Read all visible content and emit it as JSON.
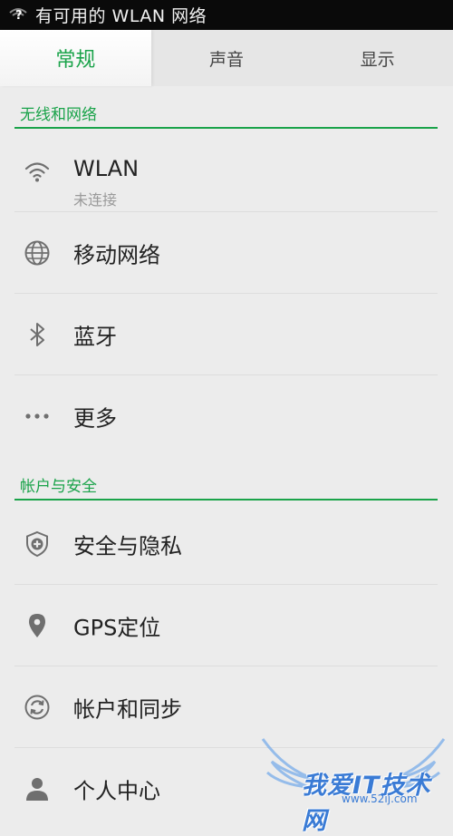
{
  "status_bar": {
    "wifi_symbol": "?",
    "text": "有可用的 WLAN 网络"
  },
  "tabs": [
    {
      "label": "常规",
      "active": true
    },
    {
      "label": "声音",
      "active": false
    },
    {
      "label": "显示",
      "active": false
    }
  ],
  "sections": [
    {
      "title": "无线和网络",
      "items": [
        {
          "label": "WLAN",
          "sub": "未连接",
          "icon": "wifi-icon"
        },
        {
          "label": "移动网络",
          "icon": "globe-icon"
        },
        {
          "label": "蓝牙",
          "icon": "bluetooth-icon"
        },
        {
          "label": "更多",
          "icon": "more-dots-icon"
        }
      ]
    },
    {
      "title": "帐户与安全",
      "items": [
        {
          "label": "安全与隐私",
          "icon": "shield-icon"
        },
        {
          "label": "GPS定位",
          "icon": "location-pin-icon"
        },
        {
          "label": "帐户和同步",
          "icon": "sync-icon"
        },
        {
          "label": "个人中心",
          "icon": "person-icon"
        }
      ]
    }
  ],
  "watermark": {
    "text": "我爱IT技术网",
    "url": "www.52ij.com"
  },
  "colors": {
    "accent": "#1aa34a",
    "status_bar_bg": "#0a0a0a",
    "background": "#ececec"
  }
}
